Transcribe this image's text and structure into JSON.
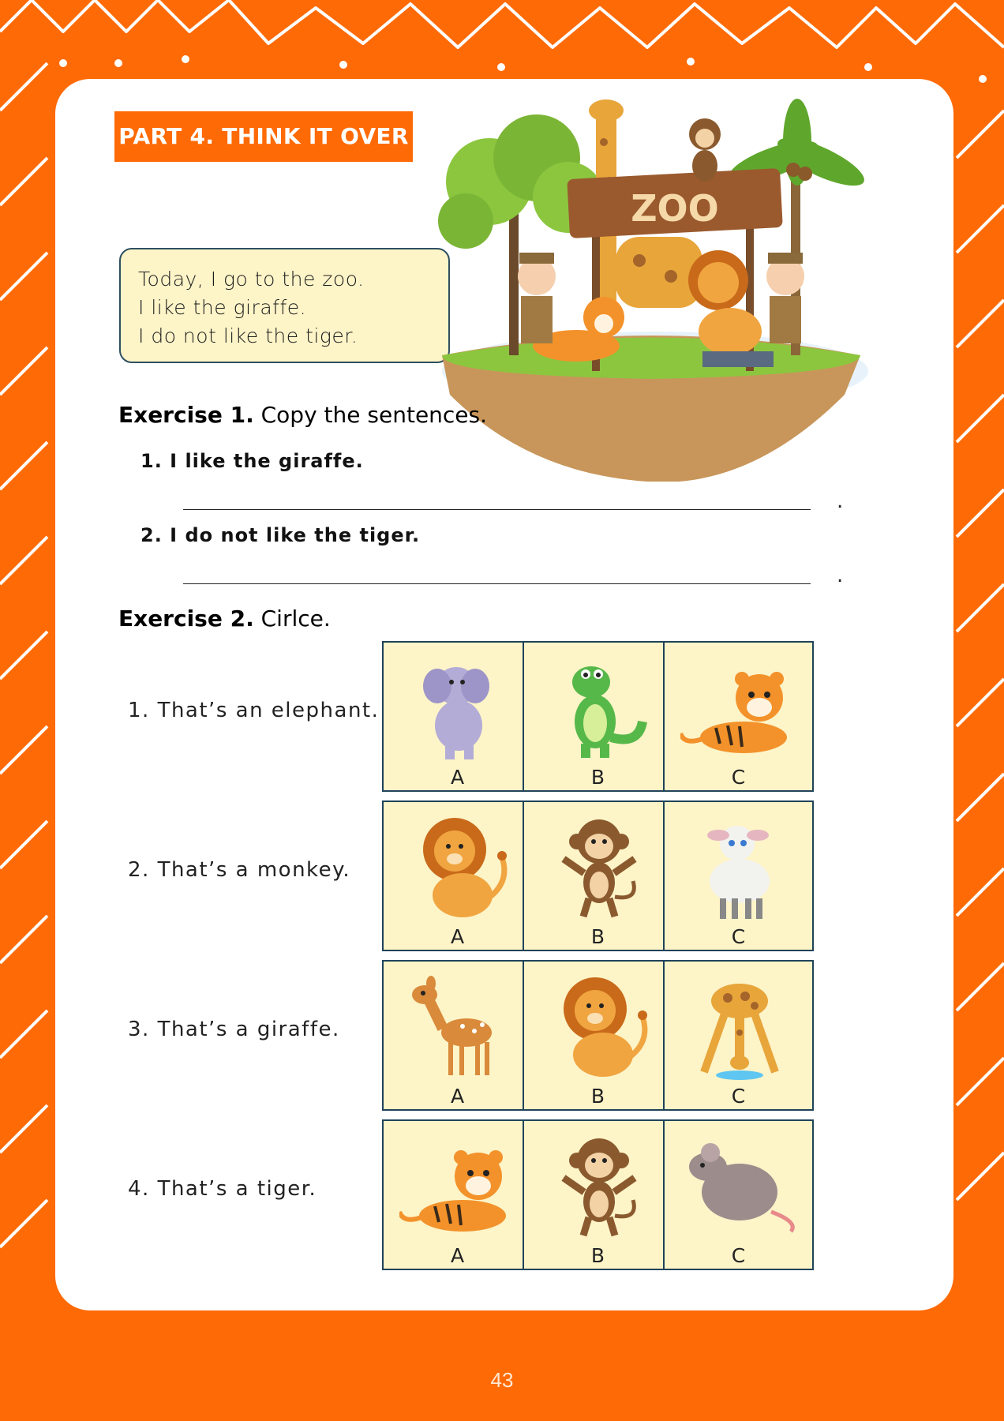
{
  "part_title": "PART 4. THINK IT OVER",
  "reading": [
    "Today, I go to the zoo.",
    "I like the giraffe.",
    "I do not like the tiger."
  ],
  "zoo_sign": "ZOO",
  "exercise1": {
    "label": "Exercise 1.",
    "instruction": "Copy the sentences.",
    "sentences": [
      "1. I like the giraffe.",
      "2. I do not like the tiger."
    ]
  },
  "exercise2": {
    "label": "Exercise 2.",
    "instruction": "Cirlce.",
    "questions": [
      {
        "text": "1. That’s an elephant.",
        "options": [
          {
            "label": "A",
            "animal": "elephant"
          },
          {
            "label": "B",
            "animal": "crocodile"
          },
          {
            "label": "C",
            "animal": "tiger"
          }
        ]
      },
      {
        "text": "2. That’s a monkey.",
        "options": [
          {
            "label": "A",
            "animal": "lion"
          },
          {
            "label": "B",
            "animal": "monkey"
          },
          {
            "label": "C",
            "animal": "sheep"
          }
        ]
      },
      {
        "text": "3. That’s a giraffe.",
        "options": [
          {
            "label": "A",
            "animal": "deer"
          },
          {
            "label": "B",
            "animal": "lion"
          },
          {
            "label": "C",
            "animal": "giraffe"
          }
        ]
      },
      {
        "text": "4. That’s a tiger.",
        "options": [
          {
            "label": "A",
            "animal": "tiger"
          },
          {
            "label": "B",
            "animal": "monkey"
          },
          {
            "label": "C",
            "animal": "mouse"
          }
        ]
      }
    ]
  },
  "page_number": "43",
  "colors": {
    "accent": "#fe6a06",
    "cell_bg": "#fdf4c8",
    "cell_border": "#20435a"
  }
}
